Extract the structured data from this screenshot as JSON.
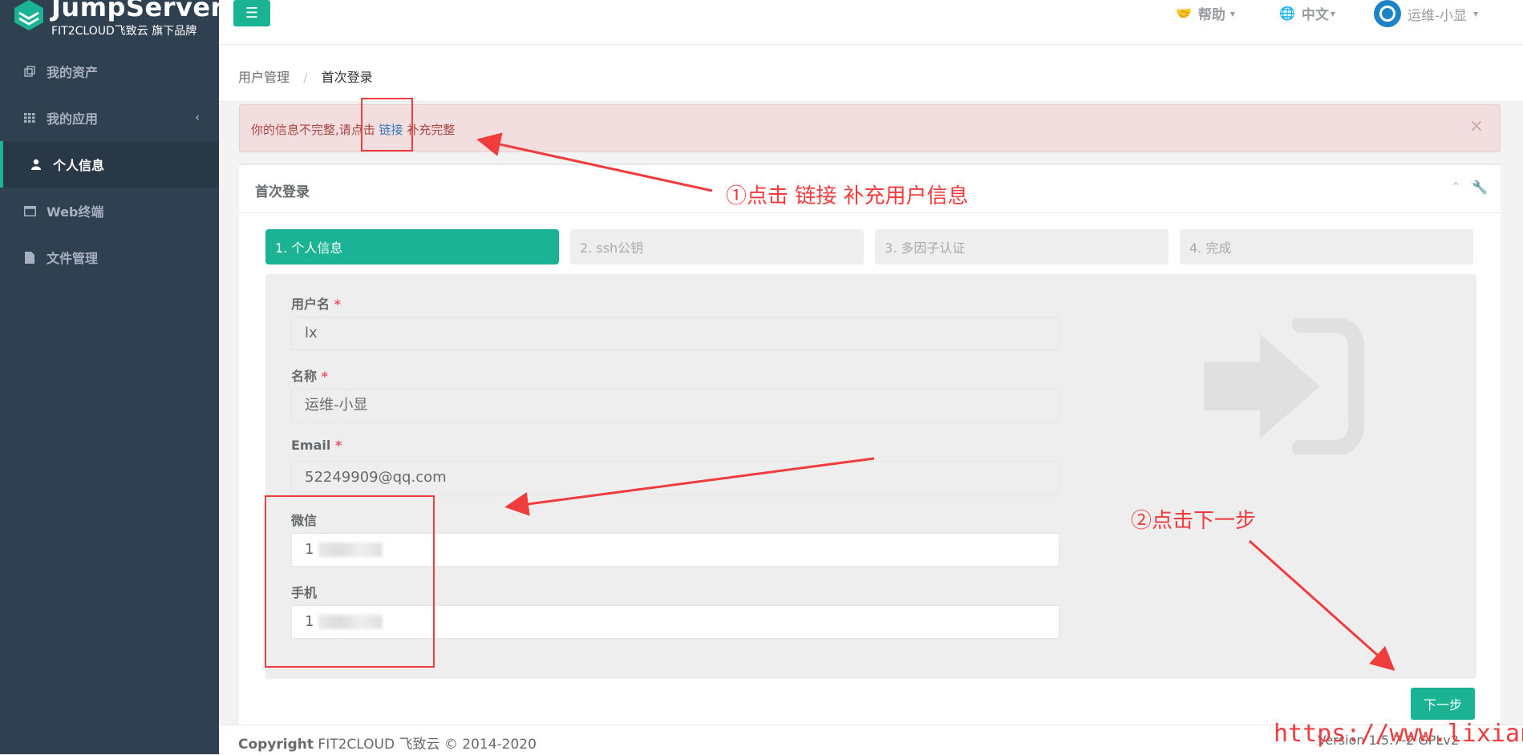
{
  "brand": {
    "name": "JumpServer",
    "tagline": "FIT2CLOUD飞致云 旗下品牌",
    "accent": "#1ab394",
    "sidebar_bg": "#2f4050"
  },
  "sidebar": {
    "items": [
      {
        "label": "我的资产",
        "icon": "assets-icon"
      },
      {
        "label": "我的应用",
        "icon": "grid-icon"
      },
      {
        "label": "个人信息",
        "icon": "user-icon",
        "active": true
      },
      {
        "label": "Web终端",
        "icon": "terminal-window-icon"
      },
      {
        "label": "文件管理",
        "icon": "file-icon"
      }
    ],
    "chevron": "‹"
  },
  "topbar": {
    "help": "帮助",
    "language": "中文",
    "user": "运维-小显"
  },
  "breadcrumb": {
    "parent": "用户管理",
    "current": "首次登录"
  },
  "alert": {
    "prefix": "你的信息不完整,请点击 ",
    "link": "链接",
    "suffix": " 补充完整",
    "close": "×"
  },
  "panel": {
    "title": "首次登录",
    "steps": [
      "1. 个人信息",
      "2. ssh公钥",
      "3. 多因子认证",
      "4. 完成"
    ],
    "fields": {
      "username": {
        "label": "用户名",
        "value": "lx"
      },
      "name": {
        "label": "名称",
        "value": "运维-小显"
      },
      "email": {
        "label": "Email",
        "value": "52249909@qq.com"
      },
      "wechat": {
        "label": "微信",
        "value": "1"
      },
      "phone": {
        "label": "手机",
        "value": "1"
      }
    },
    "required_mark": "*",
    "next_button": "下一步"
  },
  "footer": {
    "copyright_bold": "Copyright",
    "copyright": " FIT2CLOUD 飞致云 © 2014-2020",
    "version": "Version 1.5.7-2 GPLv2"
  },
  "annotations": {
    "note1": "①点击  链接  补充用户信息",
    "note2": "②点击下一步",
    "watermark": "https://www.lixian.fun",
    "color": "#f03c3c"
  }
}
